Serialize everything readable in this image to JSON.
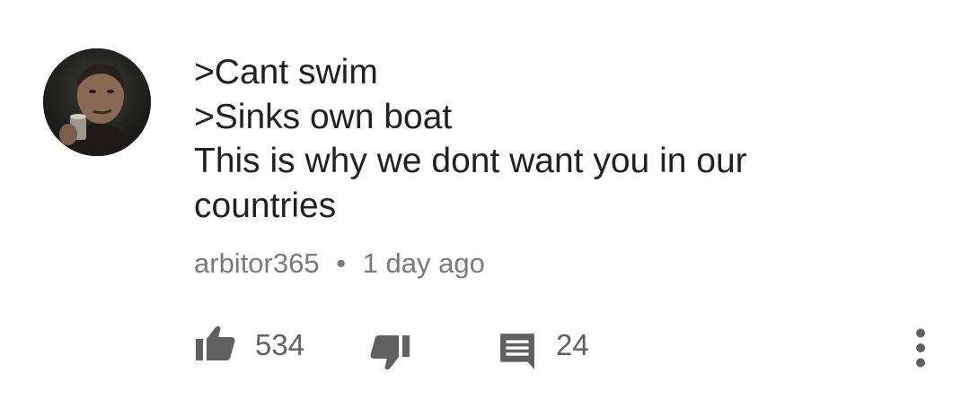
{
  "comment": {
    "body_lines": [
      ">Cant swim",
      ">Sinks own boat",
      "This is why we dont want you in our",
      "countries"
    ],
    "author": "arbitor365",
    "separator": "•",
    "timestamp": "1 day ago"
  },
  "actions": {
    "like_icon": "thumbs-up-icon",
    "like_count": "534",
    "dislike_icon": "thumbs-down-icon",
    "reply_icon": "comment-icon",
    "reply_count": "24",
    "more_icon": "more-vertical-icon"
  },
  "colors": {
    "text_primary": "#212121",
    "text_secondary": "#7a7a7a",
    "icon": "#606060",
    "background": "#ffffff"
  }
}
